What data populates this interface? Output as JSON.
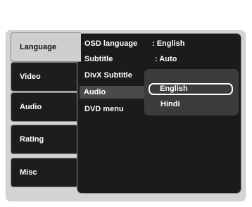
{
  "tabs": [
    {
      "label": "Language",
      "active": true
    },
    {
      "label": "Video"
    },
    {
      "label": "Audio"
    },
    {
      "label": "Rating"
    },
    {
      "label": "Misc"
    }
  ],
  "settings": [
    {
      "label": "OSD language",
      "value": ": English"
    },
    {
      "label": "Subtitle",
      "value": ": Auto"
    },
    {
      "label": "DivX Subtitle",
      "value": ""
    },
    {
      "label": "Audio",
      "value": "",
      "highlighted": true
    },
    {
      "label": "DVD menu",
      "value": ""
    }
  ],
  "dropdown": {
    "options": [
      "English",
      "Hindi"
    ],
    "selected": "English"
  },
  "colors": {
    "panel_bg": "#1b1b1b",
    "tab_inactive_bg": "#1d1d1d",
    "tab_active_bg": "#cfcfcf",
    "frame_bg": "#d4d4d4",
    "popup_bg": "#3b3b3b",
    "highlight_bg": "#4a4a4a",
    "text": "#ffffff"
  }
}
